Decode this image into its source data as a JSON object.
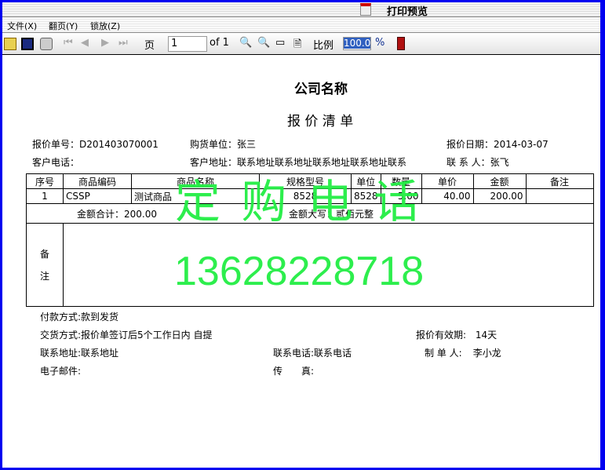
{
  "window": {
    "title": "打印预览"
  },
  "menu": [
    "文件(X)",
    "翻页(Y)",
    "锁放(Z)"
  ],
  "toolbar": {
    "page_label": "页",
    "page_value": "1",
    "of_label": "of 1",
    "scale_label": "比例",
    "scale_value": "100.0",
    "percent": "%"
  },
  "doc": {
    "company": "公司名称",
    "title": "报 价 清 单",
    "quote_no_label": "报价单号：",
    "quote_no": "D201403070001",
    "buyer_label": "购货单位：",
    "buyer": "张三",
    "date_label": "报价日期：",
    "date": "2014-03-07",
    "phone_label": "客户电话：",
    "address_label": "客户地址：",
    "address": "联系地址联系地址联系地址联系地址联系",
    "contact_label": "联 系 人：",
    "contact": "张飞",
    "columns": [
      "序号",
      "商品编码",
      "商品名称",
      "规格型号",
      "单位",
      "数量",
      "单价",
      "金额",
      "备注"
    ],
    "rows": [
      [
        "1",
        "CSSP",
        "测试商品",
        "8528",
        "8528",
        "5.00",
        "40.00",
        "200.00",
        ""
      ]
    ],
    "total_label": "金额合计：",
    "total": "200.00",
    "total_cn_label": "金额大写：",
    "total_cn": "贰佰元整",
    "remark_label_1": "备",
    "remark_label_2": "注",
    "payment": "付款方式:款到发货",
    "delivery": "交货方式:报价单签订后5个工作日内 自提",
    "validity_label": "报价有效期:",
    "validity": "14天",
    "contact_addr": "联系地址:联系地址",
    "contact_phone": "联系电话:联系电话",
    "maker_label": "制 单 人:",
    "maker": "李小龙",
    "email": "电子邮件:",
    "fax": "传　　真:"
  },
  "watermark": {
    "text": "定 购 电 话",
    "phone": "13628228718",
    "color": "#22ee44"
  }
}
